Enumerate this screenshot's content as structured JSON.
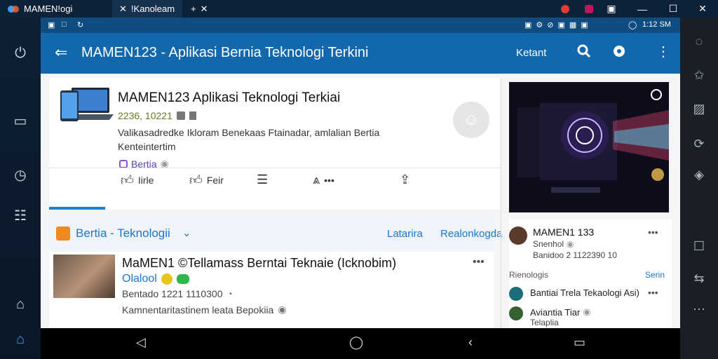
{
  "window": {
    "tab1_title": "MAMEN!ogi",
    "tab2_title": "!Kanoleam",
    "tab_new": "+",
    "tab_close": "✕"
  },
  "status": {
    "time": "1:12 SM"
  },
  "appbar": {
    "title": "MAMEN123 - Aplikasi Bernia Teknologi Terkini",
    "action_text": "Ketant"
  },
  "post1": {
    "title": "MAMEN123 Aplikasi Teknologi Terkiai",
    "meta": "2236, 10221",
    "desc_line1": "Valikasadredke Ikloram Benekaas Ftainadar, amlalian Bertia",
    "desc_line2": "Kenteintertim",
    "tag": "Bertia",
    "actions": {
      "like": "Iirle",
      "share": "Feir"
    }
  },
  "section": {
    "title": "Bertia - Teknologii",
    "link1": "Latarira",
    "link2": "Realonkogda"
  },
  "post2": {
    "title": "MaMEN1 ©Tellamass Berntai Teknaie (Icknobim)",
    "source": "Olalool",
    "meta": "Bentado 1221 1110300",
    "desc": "Kamnentaritastinem leata Bepokiia"
  },
  "profile": {
    "name": "MAMEN1 133",
    "sub": "Snenhol",
    "meta": "Banidoo 2 1122390  10",
    "section_label": "Rienologis",
    "section_link": "Serin",
    "item1": "Bantiai Trela Tekaologi Asi)",
    "item2": "Aviantia Tiar",
    "item2_sub": "Telaplia"
  }
}
